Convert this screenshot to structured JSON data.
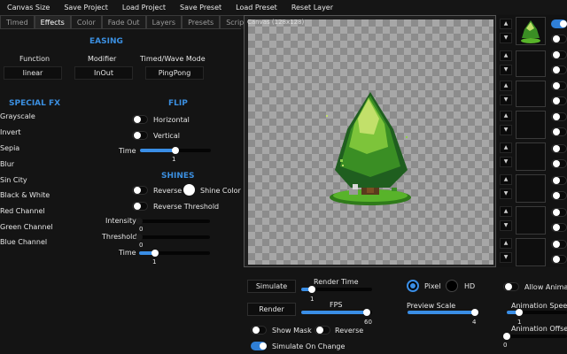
{
  "menu": [
    "Canvas Size",
    "Save Project",
    "Load Project",
    "Save Preset",
    "Load Preset",
    "Reset Layer"
  ],
  "tabs": [
    "Timed",
    "Effects",
    "Color",
    "Fade Out",
    "Layers",
    "Presets",
    "Scripts"
  ],
  "active_tab": "Effects",
  "easing": {
    "heading": "EASING",
    "function_label": "Function",
    "function_value": "linear",
    "modifier_label": "Modifier",
    "modifier_value": "InOut",
    "mode_label": "Timed/Wave Mode",
    "mode_value": "PingPong"
  },
  "special_fx": {
    "heading": "SPECIAL FX",
    "items": [
      "Grayscale",
      "Invert",
      "Sepia",
      "Blur",
      "Sin City",
      "Black & White",
      "Red Channel",
      "Green Channel",
      "Blue Channel"
    ]
  },
  "flip": {
    "heading": "FLIP",
    "horizontal": "Horizontal",
    "vertical": "Vertical",
    "time_label": "Time",
    "time_value": "1"
  },
  "shines": {
    "heading": "SHINES",
    "reverse": "Reverse",
    "shine_color": "Shine Color",
    "reverse_threshold": "Reverse Threshold",
    "intensity_label": "Intensity",
    "intensity_value": "0",
    "threshold_label": "Threshold",
    "threshold_value": "0",
    "time_label": "Time",
    "time_value": "1"
  },
  "canvas": {
    "title": "Canvas (128x128)"
  },
  "bottom": {
    "simulate_button": "Simulate",
    "render_time_label": "Render Time",
    "render_time_value": "1",
    "render_button": "Render",
    "fps_label": "FPS",
    "fps_value": "60",
    "show_mask": "Show Mask",
    "reverse": "Reverse",
    "simulate_on_change": "Simulate On Change",
    "pixel_label": "Pixel",
    "hd_label": "HD",
    "preview_scale_label": "Preview Scale",
    "preview_scale_value": "4",
    "allow_animation": "Allow Anima",
    "animation_speed_label": "Animation Speed",
    "animation_speed_value": "1",
    "animation_offset_label": "Animation Offset",
    "animation_offset_value": "0"
  },
  "colors": {
    "accent": "#3a8ee6",
    "heading": "#3b8fe0",
    "background": "#141414"
  }
}
